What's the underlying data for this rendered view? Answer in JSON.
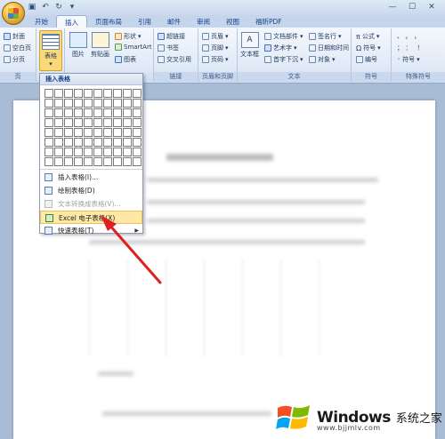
{
  "tabs": [
    "开始",
    "插入",
    "页面布局",
    "引用",
    "邮件",
    "审阅",
    "视图",
    "福昕PDF"
  ],
  "active_tab": 1,
  "ribbon": {
    "pages_group": {
      "label": "页",
      "items": [
        "封面",
        "空白页",
        "分页"
      ]
    },
    "table_btn": "表格",
    "illus": {
      "picture": "图片",
      "clipart": "剪贴画",
      "shapes": "形状",
      "smartart": "SmartArt",
      "chart": "图表"
    },
    "links": {
      "label": "链接",
      "items": [
        "超链接",
        "书签",
        "交叉引用"
      ]
    },
    "header_footer": {
      "label": "页眉和页脚",
      "items": [
        "页眉",
        "页脚",
        "页码"
      ]
    },
    "text": {
      "label": "文本",
      "textbox": "文本框",
      "items_a": [
        "文档部件",
        "艺术字",
        "首字下沉"
      ],
      "items_b": [
        "签名行",
        "日期和时间",
        "对象"
      ]
    },
    "symbols": {
      "label": "符号",
      "items": [
        "公式",
        "符号",
        "编号"
      ]
    },
    "special": {
      "label": "特殊符号",
      "items": [
        "符号"
      ]
    }
  },
  "dropdown": {
    "header": "插入表格",
    "menu": [
      {
        "label": "插入表格(I)...",
        "disabled": false,
        "highlight": false
      },
      {
        "label": "绘制表格(D)",
        "disabled": false,
        "highlight": false
      },
      {
        "label": "文本转换成表格(V)...",
        "disabled": true,
        "highlight": false
      },
      {
        "label": "Excel 电子表格(X)",
        "disabled": false,
        "highlight": true
      },
      {
        "label": "快速表格(T)",
        "disabled": false,
        "highlight": false,
        "submenu": true
      }
    ]
  },
  "watermark": {
    "brand": "Windows",
    "cn": "系统之家",
    "url": "www.bjjmlv.com"
  },
  "colors": {
    "accent": "#15428b",
    "ribbon": "#e1eaf6",
    "annotation": "#e02020",
    "highlight": "#ffe8a6"
  }
}
